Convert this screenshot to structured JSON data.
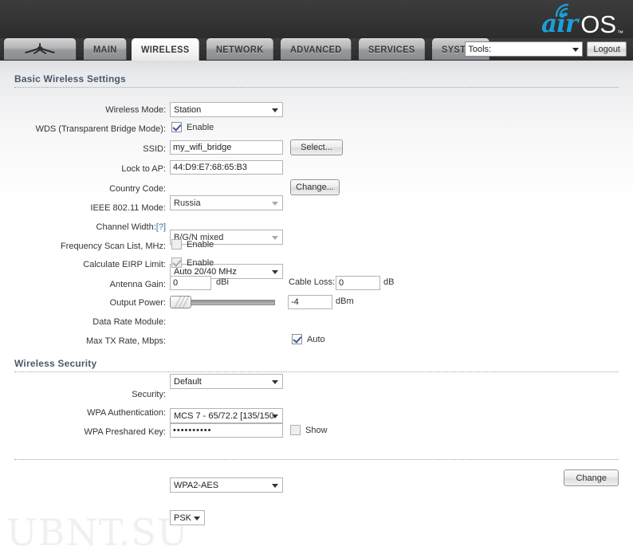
{
  "header": {
    "logo_air": "air",
    "logo_os": "OS",
    "logo_tm": "™",
    "wifi_icon": "wifi-signal-icon"
  },
  "tabs": [
    {
      "id": "home",
      "label": "",
      "active": false,
      "icon": "ubiquiti-logo-icon"
    },
    {
      "id": "main",
      "label": "MAIN",
      "active": false
    },
    {
      "id": "wireless",
      "label": "WIRELESS",
      "active": true
    },
    {
      "id": "network",
      "label": "NETWORK",
      "active": false
    },
    {
      "id": "advanced",
      "label": "ADVANCED",
      "active": false
    },
    {
      "id": "services",
      "label": "SERVICES",
      "active": false
    },
    {
      "id": "system",
      "label": "SYSTEM",
      "active": false
    }
  ],
  "toolbar": {
    "tools_value": "Tools:",
    "logout_label": "Logout"
  },
  "sections": {
    "basic": {
      "title": "Basic Wireless Settings"
    },
    "security": {
      "title": "Wireless Security"
    }
  },
  "fields": {
    "wireless_mode": {
      "label": "Wireless Mode:",
      "value": "Station"
    },
    "wds": {
      "label": "WDS (Transparent Bridge Mode):",
      "checkbox_label": "Enable",
      "checked": true,
      "disabled": false
    },
    "ssid": {
      "label": "SSID:",
      "value": "my_wifi_bridge",
      "button": "Select..."
    },
    "lock_to_ap": {
      "label": "Lock to AP:",
      "value": "44:D9:E7:68:65:B3"
    },
    "country_code": {
      "label": "Country Code:",
      "value": "Russia",
      "button": "Change..."
    },
    "ieee_mode": {
      "label": "IEEE 802.11 Mode:",
      "value": "B/G/N mixed"
    },
    "channel_width": {
      "label": "Channel Width:",
      "help": "[?]",
      "value": "Auto 20/40 MHz"
    },
    "freq_scan": {
      "label": "Frequency Scan List, MHz:",
      "checkbox_label": "Enable",
      "checked": false,
      "disabled": true
    },
    "calc_eirp": {
      "label": "Calculate EIRP Limit:",
      "checkbox_label": "Enable",
      "checked": true,
      "disabled": true
    },
    "antenna_gain": {
      "label": "Antenna Gain:",
      "value": "0",
      "unit": "dBi"
    },
    "cable_loss": {
      "label": "Cable Loss:",
      "value": "0",
      "unit": "dB"
    },
    "output_power": {
      "label": "Output Power:",
      "value": "-4",
      "unit": "dBm",
      "slider_percent": 0
    },
    "data_rate": {
      "label": "Data Rate Module:",
      "value": "Default"
    },
    "max_tx_rate": {
      "label": "Max TX Rate, Mbps:",
      "value": "MCS 7 - 65/72.2 [135/150",
      "checkbox_label": "Auto",
      "checked": true
    },
    "security": {
      "label": "Security:",
      "value": "WPA2-AES"
    },
    "wpa_auth": {
      "label": "WPA Authentication:",
      "value": "PSK"
    },
    "wpa_key": {
      "label": "WPA Preshared Key:",
      "value": "••••••••••",
      "checkbox_label": "Show",
      "checked": false
    }
  },
  "footer": {
    "change_label": "Change",
    "watermark": "UBNT.SU"
  }
}
